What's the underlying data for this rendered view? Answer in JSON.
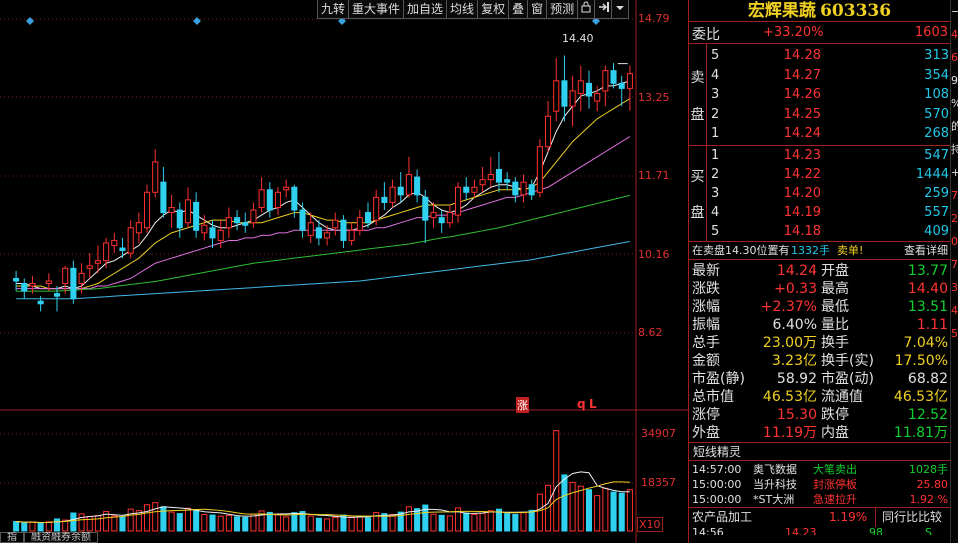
{
  "toolbar": {
    "buttons": [
      "九转",
      "重大事件",
      "加自选",
      "均线",
      "复权",
      "叠",
      "窗",
      "预测"
    ],
    "icons": [
      "lock-icon",
      "exit-icon",
      "dropdown-icon"
    ]
  },
  "chart_data": {
    "type": "candlestick",
    "price_axis_labels": [
      "14.79",
      "13.25",
      "11.71",
      "10.16",
      "8.62"
    ],
    "volume_axis_labels": [
      "34907",
      "18357"
    ],
    "volume_multiplier": "X10",
    "annotations": {
      "high_price": "14.40",
      "zhang_marker": "涨",
      "q_marker": "q",
      "l_marker": "L"
    },
    "ylim": [
      7.9,
      15.3
    ],
    "volume_ylim": [
      0,
      40000
    ],
    "candles": [
      {
        "o": 10.2,
        "c": 10.15,
        "h": 10.35,
        "l": 9.95,
        "v": 3200
      },
      {
        "o": 10.1,
        "c": 9.95,
        "h": 10.2,
        "l": 9.8,
        "v": 2800
      },
      {
        "o": 10.05,
        "c": 10.1,
        "h": 10.25,
        "l": 9.9,
        "v": 3000
      },
      {
        "o": 9.75,
        "c": 9.7,
        "h": 9.85,
        "l": 9.55,
        "v": 2600
      },
      {
        "o": 10.1,
        "c": 10.15,
        "h": 10.3,
        "l": 9.95,
        "v": 3100
      },
      {
        "o": 9.9,
        "c": 9.85,
        "h": 10.05,
        "l": 9.55,
        "v": 4100
      },
      {
        "o": 10.1,
        "c": 10.4,
        "h": 10.45,
        "l": 9.9,
        "v": 3700
      },
      {
        "o": 10.4,
        "c": 9.8,
        "h": 10.55,
        "l": 9.7,
        "v": 6100
      },
      {
        "o": 10.1,
        "c": 10.3,
        "h": 10.5,
        "l": 9.9,
        "v": 5800
      },
      {
        "o": 10.4,
        "c": 10.45,
        "h": 10.7,
        "l": 10.2,
        "v": 4900
      },
      {
        "o": 10.5,
        "c": 10.55,
        "h": 10.85,
        "l": 10.3,
        "v": 5200
      },
      {
        "o": 10.55,
        "c": 10.9,
        "h": 11.0,
        "l": 10.4,
        "v": 6600
      },
      {
        "o": 10.85,
        "c": 10.95,
        "h": 11.1,
        "l": 10.7,
        "v": 5100
      },
      {
        "o": 10.8,
        "c": 10.75,
        "h": 11.0,
        "l": 10.6,
        "v": 4700
      },
      {
        "o": 10.7,
        "c": 11.2,
        "h": 11.35,
        "l": 10.6,
        "v": 7400
      },
      {
        "o": 11.1,
        "c": 11.3,
        "h": 11.5,
        "l": 10.9,
        "v": 6900
      },
      {
        "o": 11.2,
        "c": 11.9,
        "h": 12.05,
        "l": 11.1,
        "v": 8900
      },
      {
        "o": 11.9,
        "c": 12.5,
        "h": 12.75,
        "l": 11.8,
        "v": 9600
      },
      {
        "o": 12.1,
        "c": 11.5,
        "h": 12.4,
        "l": 11.4,
        "v": 8200
      },
      {
        "o": 11.5,
        "c": 11.6,
        "h": 11.85,
        "l": 11.2,
        "v": 6400
      },
      {
        "o": 11.55,
        "c": 11.2,
        "h": 11.7,
        "l": 11.0,
        "v": 5900
      },
      {
        "o": 11.3,
        "c": 11.75,
        "h": 12.0,
        "l": 11.2,
        "v": 7700
      },
      {
        "o": 11.7,
        "c": 11.15,
        "h": 11.9,
        "l": 11.0,
        "v": 7000
      },
      {
        "o": 11.1,
        "c": 11.25,
        "h": 11.45,
        "l": 10.95,
        "v": 5600
      },
      {
        "o": 11.2,
        "c": 11.0,
        "h": 11.35,
        "l": 10.8,
        "v": 5400
      },
      {
        "o": 10.95,
        "c": 11.15,
        "h": 11.35,
        "l": 10.8,
        "v": 5000
      },
      {
        "o": 11.2,
        "c": 11.4,
        "h": 11.6,
        "l": 11.0,
        "v": 5300
      },
      {
        "o": 11.4,
        "c": 11.3,
        "h": 11.55,
        "l": 11.15,
        "v": 4800
      },
      {
        "o": 11.3,
        "c": 11.25,
        "h": 11.5,
        "l": 11.1,
        "v": 4600
      },
      {
        "o": 11.3,
        "c": 11.55,
        "h": 11.7,
        "l": 11.2,
        "v": 5700
      },
      {
        "o": 11.6,
        "c": 11.95,
        "h": 12.2,
        "l": 11.5,
        "v": 6800
      },
      {
        "o": 11.95,
        "c": 11.55,
        "h": 12.1,
        "l": 11.4,
        "v": 6300
      },
      {
        "o": 11.6,
        "c": 11.9,
        "h": 12.0,
        "l": 11.45,
        "v": 5500
      },
      {
        "o": 11.95,
        "c": 12.0,
        "h": 12.15,
        "l": 11.8,
        "v": 4800
      },
      {
        "o": 12.0,
        "c": 11.55,
        "h": 12.05,
        "l": 11.4,
        "v": 6200
      },
      {
        "o": 11.55,
        "c": 11.15,
        "h": 11.7,
        "l": 11.0,
        "v": 6600
      },
      {
        "o": 11.05,
        "c": 11.3,
        "h": 11.5,
        "l": 10.9,
        "v": 5100
      },
      {
        "o": 11.2,
        "c": 11.0,
        "h": 11.35,
        "l": 10.85,
        "v": 4300
      },
      {
        "o": 11.0,
        "c": 11.1,
        "h": 11.25,
        "l": 10.85,
        "v": 4100
      },
      {
        "o": 11.2,
        "c": 11.35,
        "h": 11.5,
        "l": 11.05,
        "v": 4600
      },
      {
        "o": 11.35,
        "c": 10.95,
        "h": 11.45,
        "l": 10.8,
        "v": 5400
      },
      {
        "o": 10.95,
        "c": 11.15,
        "h": 11.3,
        "l": 10.85,
        "v": 4700
      },
      {
        "o": 11.15,
        "c": 11.4,
        "h": 11.55,
        "l": 11.05,
        "v": 4900
      },
      {
        "o": 11.5,
        "c": 11.3,
        "h": 11.7,
        "l": 11.2,
        "v": 4500
      },
      {
        "o": 11.35,
        "c": 11.8,
        "h": 11.95,
        "l": 11.25,
        "v": 6300
      },
      {
        "o": 11.8,
        "c": 11.7,
        "h": 12.1,
        "l": 11.55,
        "v": 5900
      },
      {
        "o": 11.7,
        "c": 12.0,
        "h": 12.15,
        "l": 11.6,
        "v": 5600
      },
      {
        "o": 12.0,
        "c": 11.85,
        "h": 12.3,
        "l": 11.7,
        "v": 6400
      },
      {
        "o": 11.85,
        "c": 12.25,
        "h": 12.6,
        "l": 11.8,
        "v": 8200
      },
      {
        "o": 12.2,
        "c": 11.85,
        "h": 12.35,
        "l": 11.7,
        "v": 7600
      },
      {
        "o": 11.8,
        "c": 11.35,
        "h": 11.95,
        "l": 10.9,
        "v": 8800
      },
      {
        "o": 11.4,
        "c": 11.5,
        "h": 11.7,
        "l": 11.2,
        "v": 5700
      },
      {
        "o": 11.4,
        "c": 11.3,
        "h": 11.55,
        "l": 11.1,
        "v": 5300
      },
      {
        "o": 11.3,
        "c": 11.5,
        "h": 11.65,
        "l": 11.2,
        "v": 5100
      },
      {
        "o": 11.45,
        "c": 12.0,
        "h": 12.1,
        "l": 11.3,
        "v": 7800
      },
      {
        "o": 12.0,
        "c": 11.9,
        "h": 12.2,
        "l": 11.75,
        "v": 6100
      },
      {
        "o": 11.9,
        "c": 12.0,
        "h": 12.15,
        "l": 11.8,
        "v": 5600
      },
      {
        "o": 12.05,
        "c": 12.15,
        "h": 12.4,
        "l": 11.9,
        "v": 6000
      },
      {
        "o": 12.15,
        "c": 12.25,
        "h": 12.6,
        "l": 12.0,
        "v": 6900
      },
      {
        "o": 12.35,
        "c": 12.1,
        "h": 12.7,
        "l": 11.9,
        "v": 7400
      },
      {
        "o": 12.15,
        "c": 12.1,
        "h": 12.3,
        "l": 11.95,
        "v": 5900
      },
      {
        "o": 12.1,
        "c": 11.85,
        "h": 12.2,
        "l": 11.7,
        "v": 5600
      },
      {
        "o": 11.85,
        "c": 12.1,
        "h": 12.25,
        "l": 11.7,
        "v": 6200
      },
      {
        "o": 12.05,
        "c": 11.85,
        "h": 12.15,
        "l": 11.75,
        "v": 7000
      },
      {
        "o": 11.9,
        "c": 12.8,
        "h": 12.95,
        "l": 11.8,
        "v": 12500
      },
      {
        "o": 12.8,
        "c": 13.4,
        "h": 13.7,
        "l": 12.7,
        "v": 15500
      },
      {
        "o": 13.5,
        "c": 14.1,
        "h": 14.55,
        "l": 13.3,
        "v": 34000
      },
      {
        "o": 14.1,
        "c": 13.6,
        "h": 14.6,
        "l": 13.3,
        "v": 19000
      },
      {
        "o": 13.6,
        "c": 13.9,
        "h": 14.2,
        "l": 13.2,
        "v": 16500
      },
      {
        "o": 13.85,
        "c": 14.1,
        "h": 14.4,
        "l": 13.5,
        "v": 15200
      },
      {
        "o": 14.05,
        "c": 13.8,
        "h": 14.3,
        "l": 13.55,
        "v": 14000
      },
      {
        "o": 13.7,
        "c": 13.85,
        "h": 14.0,
        "l": 13.5,
        "v": 12000
      },
      {
        "o": 13.9,
        "c": 14.3,
        "h": 14.4,
        "l": 13.6,
        "v": 14500
      },
      {
        "o": 14.3,
        "c": 14.05,
        "h": 14.45,
        "l": 13.95,
        "v": 13200
      },
      {
        "o": 14.05,
        "c": 13.95,
        "h": 14.2,
        "l": 13.6,
        "v": 12800
      },
      {
        "o": 13.95,
        "c": 14.24,
        "h": 14.4,
        "l": 13.51,
        "v": 14000
      }
    ],
    "ma_lines": [
      {
        "name": "ma-white",
        "color": "#f0f0f0",
        "values": [
          10.1,
          10.1,
          10.05,
          10.0,
          10.0,
          10.0,
          10.05,
          10.0,
          10.05,
          10.2,
          10.35,
          10.5,
          10.55,
          10.65,
          10.75,
          10.85,
          11.05,
          11.3,
          11.45,
          11.55,
          11.5,
          11.55,
          11.45,
          11.35,
          11.25,
          11.2,
          11.2,
          11.25,
          11.3,
          11.35,
          11.45,
          11.55,
          11.6,
          11.7,
          11.75,
          11.6,
          11.45,
          11.3,
          11.2,
          11.15,
          11.15,
          11.15,
          11.2,
          11.25,
          11.35,
          11.45,
          11.6,
          11.7,
          11.85,
          11.9,
          11.8,
          11.65,
          11.55,
          11.5,
          11.55,
          11.65,
          11.8,
          11.9,
          12.0,
          12.05,
          12.05,
          12.0,
          11.95,
          12.0,
          12.3,
          12.7,
          13.1,
          13.4,
          13.6,
          13.8,
          13.85,
          13.9,
          14.0,
          14.0,
          14.05,
          14.1
        ]
      },
      {
        "name": "ma-yellow",
        "color": "#f0d020",
        "values": [
          10.05,
          10.05,
          10.05,
          10.05,
          10.0,
          10.0,
          10.0,
          10.0,
          10.0,
          10.05,
          10.1,
          10.2,
          10.3,
          10.4,
          10.5,
          10.6,
          10.75,
          10.9,
          11.0,
          11.1,
          11.15,
          11.2,
          11.25,
          11.3,
          11.35,
          11.35,
          11.35,
          11.3,
          11.3,
          11.3,
          11.3,
          11.35,
          11.4,
          11.45,
          11.5,
          11.5,
          11.45,
          11.4,
          11.35,
          11.35,
          11.3,
          11.3,
          11.3,
          11.3,
          11.35,
          11.4,
          11.45,
          11.5,
          11.55,
          11.6,
          11.65,
          11.65,
          11.65,
          11.65,
          11.7,
          11.75,
          11.8,
          11.85,
          11.9,
          11.95,
          11.95,
          11.95,
          11.95,
          12.0,
          12.1,
          12.3,
          12.5,
          12.7,
          12.9,
          13.05,
          13.2,
          13.35,
          13.45,
          13.55,
          13.65,
          13.75
        ]
      },
      {
        "name": "ma-magenta",
        "color": "#e070e0",
        "values": [
          10.0,
          10.0,
          10.0,
          10.0,
          10.0,
          10.0,
          10.0,
          10.0,
          10.0,
          10.0,
          10.05,
          10.05,
          10.1,
          10.15,
          10.2,
          10.3,
          10.4,
          10.5,
          10.55,
          10.6,
          10.65,
          10.7,
          10.75,
          10.8,
          10.85,
          10.9,
          10.95,
          10.95,
          11.0,
          11.0,
          11.05,
          11.05,
          11.1,
          11.1,
          11.15,
          11.15,
          11.15,
          11.15,
          11.15,
          11.15,
          11.15,
          11.15,
          11.15,
          11.15,
          11.2,
          11.2,
          11.25,
          11.3,
          11.35,
          11.4,
          11.4,
          11.45,
          11.45,
          11.45,
          11.5,
          11.55,
          11.6,
          11.65,
          11.7,
          11.75,
          11.8,
          11.8,
          11.85,
          11.9,
          11.95,
          12.0,
          12.1,
          12.2,
          12.3,
          12.4,
          12.5,
          12.6,
          12.7,
          12.8,
          12.9,
          13.0
        ]
      },
      {
        "name": "ma-green",
        "color": "#30c030",
        "values": [
          9.95,
          9.95,
          9.95,
          9.95,
          9.95,
          9.95,
          9.96,
          9.97,
          9.98,
          9.99,
          10.0,
          10.02,
          10.04,
          10.06,
          10.08,
          10.1,
          10.12,
          10.14,
          10.17,
          10.2,
          10.23,
          10.26,
          10.29,
          10.32,
          10.35,
          10.38,
          10.41,
          10.44,
          10.47,
          10.5,
          10.52,
          10.54,
          10.56,
          10.58,
          10.6,
          10.62,
          10.64,
          10.66,
          10.68,
          10.7,
          10.72,
          10.74,
          10.76,
          10.78,
          10.8,
          10.82,
          10.84,
          10.86,
          10.88,
          10.91,
          10.94,
          10.97,
          11.0,
          11.02,
          11.05,
          11.08,
          11.11,
          11.14,
          11.17,
          11.2,
          11.24,
          11.28,
          11.32,
          11.36,
          11.4,
          11.44,
          11.48,
          11.52,
          11.56,
          11.6,
          11.64,
          11.68,
          11.72,
          11.76,
          11.8,
          11.84
        ]
      },
      {
        "name": "ma-blue",
        "color": "#40b8e8",
        "values": [
          9.8,
          9.8,
          9.8,
          9.8,
          9.8,
          9.8,
          9.8,
          9.8,
          9.81,
          9.82,
          9.83,
          9.84,
          9.85,
          9.86,
          9.87,
          9.88,
          9.89,
          9.9,
          9.91,
          9.92,
          9.93,
          9.94,
          9.95,
          9.96,
          9.97,
          9.98,
          9.99,
          10.0,
          10.01,
          10.02,
          10.03,
          10.04,
          10.05,
          10.06,
          10.07,
          10.08,
          10.09,
          10.1,
          10.11,
          10.12,
          10.13,
          10.14,
          10.15,
          10.17,
          10.19,
          10.21,
          10.23,
          10.25,
          10.27,
          10.29,
          10.31,
          10.33,
          10.35,
          10.37,
          10.39,
          10.41,
          10.43,
          10.45,
          10.47,
          10.49,
          10.51,
          10.53,
          10.55,
          10.57,
          10.6,
          10.63,
          10.66,
          10.69,
          10.72,
          10.75,
          10.78,
          10.81,
          10.84,
          10.87,
          10.9,
          10.93
        ]
      }
    ]
  },
  "quote": {
    "name": "宏辉果蔬",
    "code": "603336",
    "weibi_label": "委比",
    "weibi_pct": "+33.20%",
    "weibi_val": "1603",
    "sell_label": "卖盘",
    "buy_label": "买盘",
    "sell_side": [
      "卖",
      "盘"
    ],
    "buy_side": [
      "买",
      "盘"
    ],
    "asks": [
      {
        "lvl": "5",
        "price": "14.28",
        "qty": "313"
      },
      {
        "lvl": "4",
        "price": "14.27",
        "qty": "354"
      },
      {
        "lvl": "3",
        "price": "14.26",
        "qty": "108"
      },
      {
        "lvl": "2",
        "price": "14.25",
        "qty": "570"
      },
      {
        "lvl": "1",
        "price": "14.24",
        "qty": "268"
      }
    ],
    "bids": [
      {
        "lvl": "1",
        "price": "14.23",
        "qty": "547"
      },
      {
        "lvl": "2",
        "price": "14.22",
        "qty": "1444"
      },
      {
        "lvl": "3",
        "price": "14.20",
        "qty": "259"
      },
      {
        "lvl": "4",
        "price": "14.19",
        "qty": "557"
      },
      {
        "lvl": "5",
        "price": "14.18",
        "qty": "409"
      }
    ],
    "notice_text": "在卖盘14.30位置有",
    "notice_qty": "1332手",
    "notice_tail": "卖单!",
    "notice_link": "查看详细",
    "stats": [
      {
        "l1": "最新",
        "v1": "14.24",
        "c1": "red",
        "l2": "开盘",
        "v2": "13.77",
        "c2": "green"
      },
      {
        "l1": "涨跌",
        "v1": "+0.33",
        "c1": "red",
        "l2": "最高",
        "v2": "14.40",
        "c2": "red"
      },
      {
        "l1": "涨幅",
        "v1": "+2.37%",
        "c1": "red",
        "l2": "最低",
        "v2": "13.51",
        "c2": "green"
      },
      {
        "l1": "振幅",
        "v1": "6.40%",
        "c1": "white",
        "l2": "量比",
        "v2": "1.11",
        "c2": "red"
      },
      {
        "l1": "总手",
        "v1": "23.00万",
        "c1": "yellow",
        "l2": "换手",
        "v2": "7.04%",
        "c2": "yellow"
      },
      {
        "l1": "金额",
        "v1": "3.23亿",
        "c1": "yellow",
        "l2": "换手(实)",
        "v2": "17.50%",
        "c2": "yellow"
      },
      {
        "l1": "市盈(静)",
        "v1": "58.92",
        "c1": "white",
        "l2": "市盈(动)",
        "v2": "68.82",
        "c2": "white"
      },
      {
        "l1": "总市值",
        "v1": "46.53亿",
        "c1": "yellow",
        "l2": "流通值",
        "v2": "46.53亿",
        "c2": "yellow"
      },
      {
        "l1": "涨停",
        "v1": "15.30",
        "c1": "red",
        "l2": "跌停",
        "v2": "12.52",
        "c2": "green"
      },
      {
        "l1": "外盘",
        "v1": "11.19万",
        "c1": "red",
        "l2": "内盘",
        "v2": "11.81万",
        "c2": "green"
      }
    ],
    "short_head": "短线精灵",
    "short_lines": [
      {
        "time": "14:57:00",
        "name": "奥飞数据",
        "event": "大笔卖出",
        "val": "1028手",
        "ec": "green",
        "vc": "green"
      },
      {
        "time": "15:00:00",
        "name": "当升科技",
        "event": "封涨停板",
        "val": "25.80",
        "ec": "red",
        "vc": "red"
      },
      {
        "time": "15:00:00",
        "name": "*ST大洲",
        "event": "急速拉升",
        "val": "1.92 %",
        "ec": "red",
        "vc": "red"
      }
    ],
    "industry": "农产品加工",
    "industry_pct": "1.19%",
    "industry_btn": "同行比比较",
    "last_time": "14:56",
    "last_price": "14.23",
    "last_vol": "98",
    "last_flag": "S"
  },
  "bottom_tabs": [
    "指",
    "融资融券余额"
  ],
  "edge_glyphs": [
    "−",
    "4",
    "6",
    "9",
    "%",
    "的",
    "持",
    "+",
    "7",
    "2",
    "0",
    "7",
    "3",
    "4",
    "5"
  ]
}
